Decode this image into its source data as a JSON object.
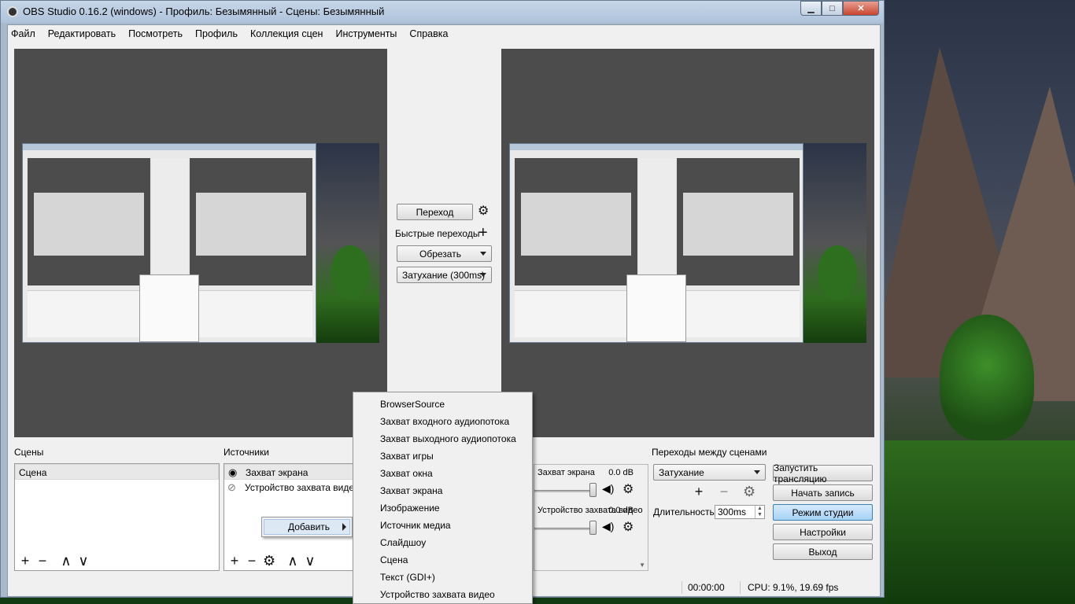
{
  "window": {
    "title": "OBS Studio 0.16.2 (windows) - Профиль: Безымянный - Сцены: Безымянный",
    "min_label": "▁",
    "max_label": "□",
    "close_label": "✕"
  },
  "menu": [
    "Файл",
    "Редактировать",
    "Посмотреть",
    "Профиль",
    "Коллекция сцен",
    "Инструменты",
    "Справка"
  ],
  "transition_panel": {
    "transition_button": "Переход",
    "quick_transitions": "Быстрые переходы",
    "cut_combo": "Обрезать",
    "fade_combo": "Затухание (300ms)"
  },
  "scenes": {
    "header": "Сцены",
    "items": [
      "Сцена"
    ]
  },
  "sources": {
    "header": "Источники",
    "items": [
      "Захват экрана",
      "Устройство захвата видео"
    ]
  },
  "mixer": {
    "channels": [
      {
        "name": "Захват экрана",
        "db": "0.0 dB"
      },
      {
        "name": "Устройство захвата видео",
        "db": "0.0 dB"
      }
    ]
  },
  "scene_transitions": {
    "header": "Переходы между сценами",
    "combo_value": "Затухание",
    "duration_label": "Длительность",
    "duration_value": "300ms"
  },
  "controls": {
    "start_stream": "Запустить трансляцию",
    "start_record": "Начать запись",
    "studio_mode": "Режим студии",
    "settings": "Настройки",
    "exit": "Выход"
  },
  "status": {
    "time": "00:00:00",
    "cpu": "CPU: 9.1%, 19.69 fps"
  },
  "context_add": {
    "label": "Добавить"
  },
  "context_sources_menu": [
    "BrowserSource",
    "Захват входного аудиопотока",
    "Захват выходного аудиопотока",
    "Захват игры",
    "Захват окна",
    "Захват экрана",
    "Изображение",
    "Источник медиа",
    "Слайдшоу",
    "Сцена",
    "Текст (GDI+)",
    "Устройство захвата видео"
  ],
  "icons": {
    "gear": "⚙",
    "plus": "+",
    "minus": "−",
    "up": "∧",
    "down": "∨",
    "eye": "👁",
    "speaker": "🔊"
  }
}
